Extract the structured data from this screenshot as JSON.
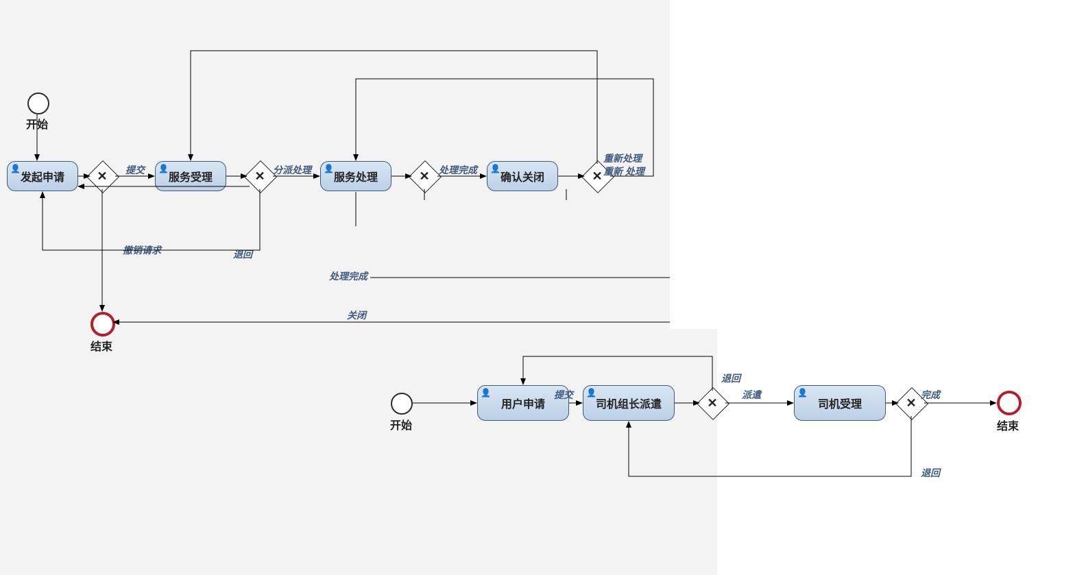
{
  "top": {
    "start": "开始",
    "end": "结束",
    "tasks": {
      "t1": "发起申请",
      "t2": "服务受理",
      "t3": "服务处理",
      "t4": "确认关闭"
    },
    "edges": {
      "submit": "提交",
      "dispatch": "分派处理",
      "done": "处理完成",
      "revoke": "撤销请求",
      "reject": "退回",
      "done2": "处理完成",
      "close": "关闭",
      "rehandle1": "重新处理",
      "rehandle2": "重新 处理"
    }
  },
  "bottom": {
    "start": "开始",
    "end": "结束",
    "tasks": {
      "b1": "用户申请",
      "b2": "司机组长派遣",
      "b3": "司机受理"
    },
    "edges": {
      "submit": "提交",
      "dispatch": "派遣",
      "reject": "退回",
      "done": "完成",
      "reject2": "退回"
    }
  }
}
